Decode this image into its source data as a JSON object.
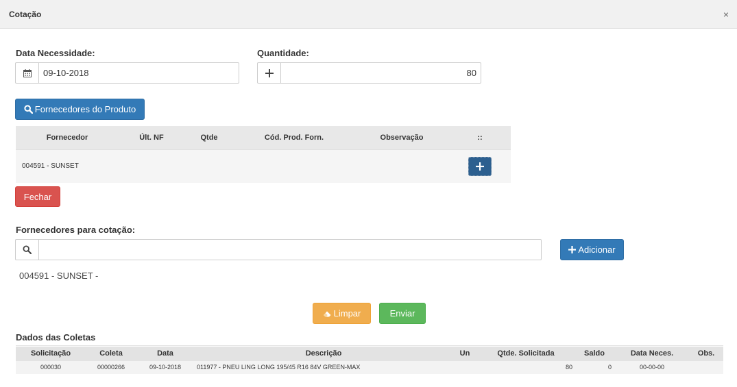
{
  "modal": {
    "title": "Cotação",
    "close": "×"
  },
  "form": {
    "date_label": "Data Necessidade:",
    "date_value": "09-10-2018",
    "qty_label": "Quantidade:",
    "qty_value": "80"
  },
  "buttons": {
    "fornecedores_produto": "Fornecedores do Produto",
    "fechar": "Fechar",
    "adicionar": "Adicionar",
    "limpar": "Limpar",
    "enviar": "Enviar"
  },
  "supplier_table": {
    "headers": [
      "Fornecedor",
      "Últ. NF",
      "Qtde",
      "Cód. Prod. Forn.",
      "Observação",
      "::"
    ],
    "rows": [
      {
        "fornecedor": "004591 - SUNSET",
        "ult_nf": "",
        "qtde": "",
        "cod_prod": "",
        "obs": ""
      }
    ]
  },
  "quote": {
    "label": "Fornecedores para cotação:",
    "search_value": "",
    "selected": [
      "004591 - SUNSET -"
    ]
  },
  "coletas": {
    "title": "Dados das Coletas",
    "headers": [
      "Solicitação",
      "Coleta",
      "Data",
      "Descrição",
      "Un",
      "Qtde. Solicitada",
      "Saldo",
      "Data Neces.",
      "Obs."
    ],
    "rows": [
      {
        "solicitacao": "000030",
        "coleta": "00000266",
        "data": "09-10-2018",
        "descricao": "011977 - PNEU LING LONG 195/45 R16 84V GREEN-MAX",
        "un": "",
        "qtde": "80",
        "saldo": "0",
        "data_neces": "00-00-00",
        "obs": ""
      }
    ]
  },
  "icons": {
    "calendar": "calendar-icon",
    "plus": "plus-icon",
    "search": "search-icon",
    "eraser": "eraser-icon",
    "close": "close-icon"
  }
}
